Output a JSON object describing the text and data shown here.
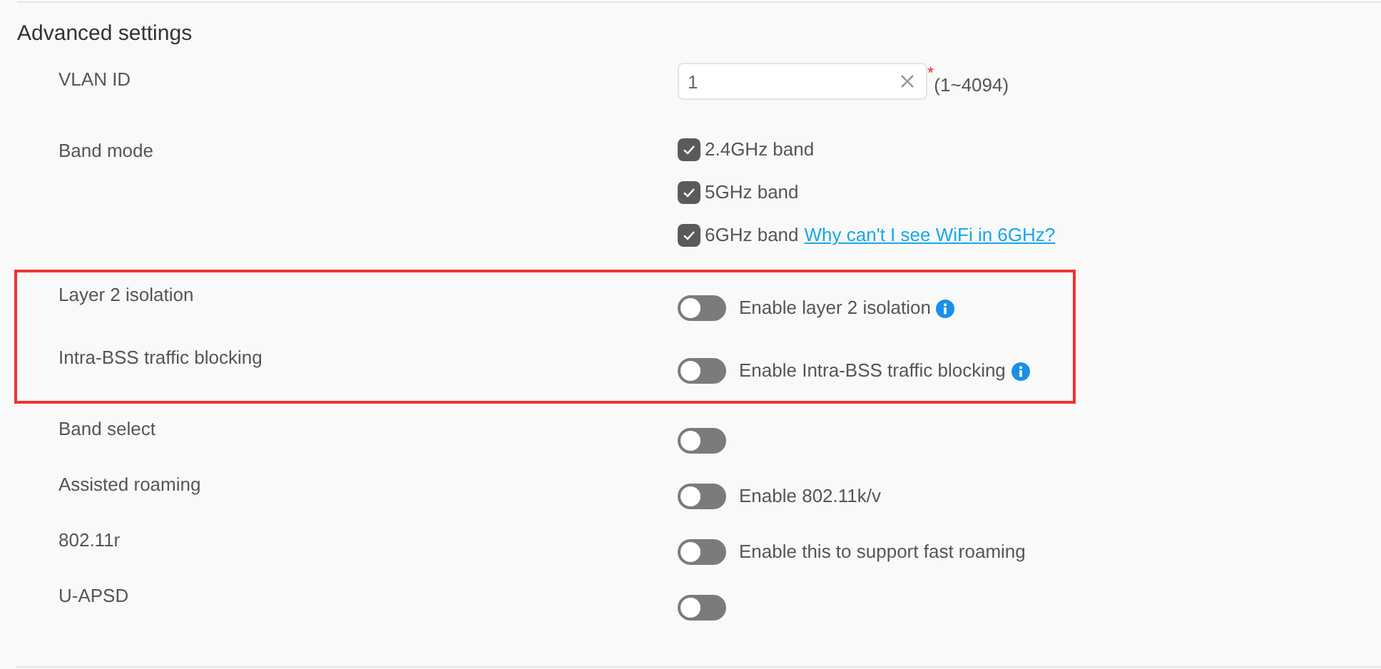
{
  "section": {
    "title": "Advanced settings"
  },
  "settings": [
    {
      "kind": "number",
      "label": "VLAN ID",
      "value": "1",
      "required_mark": "*",
      "hint": "(1~4094)",
      "highlighted": false
    },
    {
      "kind": "checks",
      "label": "Band mode",
      "highlighted": false,
      "options": [
        {
          "label": "2.4GHz band",
          "checked": true
        },
        {
          "label": "5GHz band",
          "checked": true
        },
        {
          "label": "6GHz band",
          "checked": true,
          "link": "Why can't I see WiFi in 6GHz?"
        }
      ]
    },
    {
      "kind": "toggle",
      "label": "Layer 2 isolation",
      "on": false,
      "text": "Enable layer 2 isolation",
      "info": true,
      "highlighted": true
    },
    {
      "kind": "toggle",
      "label": "Intra-BSS traffic blocking",
      "on": false,
      "text": "Enable Intra-BSS traffic blocking",
      "info": true,
      "highlighted": true
    },
    {
      "kind": "toggle",
      "label": "Band select",
      "on": false,
      "highlighted": false
    },
    {
      "kind": "toggle",
      "label": "Assisted roaming",
      "on": false,
      "text": "Enable 802.11k/v",
      "highlighted": false
    },
    {
      "kind": "toggle",
      "label": "802.11r",
      "on": false,
      "text": "Enable this to support fast roaming",
      "highlighted": false
    },
    {
      "kind": "toggle",
      "label": "U-APSD",
      "on": false,
      "highlighted": false
    }
  ]
}
